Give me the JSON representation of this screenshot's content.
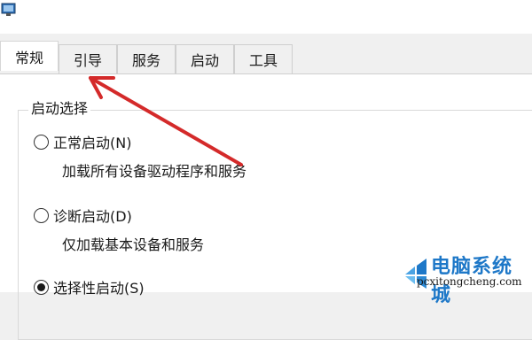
{
  "window": {
    "icon": "system-configuration-icon"
  },
  "tabs": [
    {
      "label": "常规",
      "active": true
    },
    {
      "label": "引导",
      "active": false
    },
    {
      "label": "服务",
      "active": false
    },
    {
      "label": "启动",
      "active": false
    },
    {
      "label": "工具",
      "active": false
    }
  ],
  "startup_selection": {
    "title": "启动选择",
    "options": [
      {
        "label": "正常启动(N)",
        "description": "加载所有设备驱动程序和服务",
        "checked": false
      },
      {
        "label": "诊断启动(D)",
        "description": "仅加载基本设备和服务",
        "checked": false
      },
      {
        "label": "选择性启动(S)",
        "checked": true
      }
    ]
  },
  "annotation": {
    "icon": "red-arrow-icon",
    "color": "#d42a2a"
  },
  "watermark": {
    "title": "电脑系统城",
    "url": "pcxitongcheng.com",
    "color": "#1e78c8",
    "icon": "windows-logo-icon"
  }
}
